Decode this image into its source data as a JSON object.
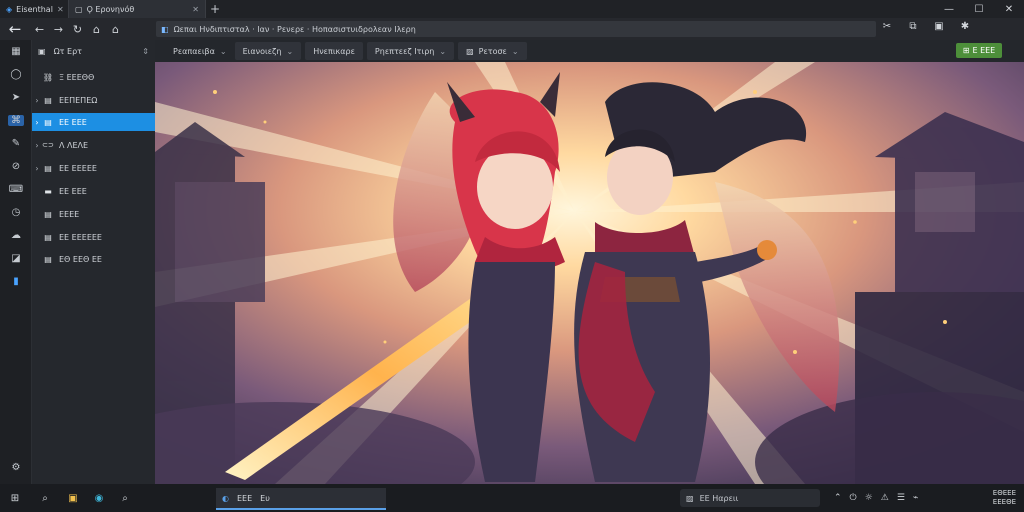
{
  "tabs": [
    {
      "label": "Eisenthal",
      "close": "✕"
    },
    {
      "label": "Ϙ Ερονηνόθ",
      "close": "✕"
    }
  ],
  "new_tab_symbol": "+",
  "window_controls": {
    "minimize": "—",
    "maximize": "☐",
    "close": "✕"
  },
  "nav": {
    "back": "←",
    "back_small": "←",
    "forward": "→",
    "reload": "↻",
    "home": "⌂",
    "home2": "⌂"
  },
  "address": {
    "text": "Ωεπαι Ηνδιπτισταλ · Ιαν · Ρενερε · Ηοπασιστυιδρολεαν Ιλερη"
  },
  "toolbar_icons": [
    "scissors-icon",
    "puzzle-icon",
    "screenshot-icon",
    "extension-icon"
  ],
  "toolbar_glyphs": [
    "✂",
    "⧉",
    "▣",
    "✱"
  ],
  "sidebar": {
    "header": "Ωτ Ερτ",
    "items": [
      {
        "label": "Ξ ΕΕΕΘΘ",
        "arrow": "",
        "icon": "⛓"
      },
      {
        "label": "ΕΕΠΕΠΕΩ",
        "arrow": "›",
        "icon": "▤"
      },
      {
        "label": "ΕΕ ΕΕΕ",
        "arrow": "›",
        "icon": "▤"
      },
      {
        "label": "Λ ΛΕΛΕ",
        "arrow": "›",
        "icon": "⊂⊃"
      },
      {
        "label": "ΕΕ ΕΕΕΕΕ",
        "arrow": "›",
        "icon": "▤"
      },
      {
        "label": "ΕΕ ΕΕΕ",
        "arrow": "",
        "icon": "▬"
      },
      {
        "label": "ΕΕΕΕ",
        "arrow": "",
        "icon": "▤"
      },
      {
        "label": "ΕΕ ΕΕΕΕΕΕ",
        "arrow": "",
        "icon": "▤"
      },
      {
        "label": "ΕΘ ΕΕΘ ΕΕ",
        "arrow": "",
        "icon": "▤"
      }
    ]
  },
  "rail_icons": [
    "grid-icon",
    "chat-icon",
    "send-icon",
    "network-icon",
    "pen-icon",
    "tag-icon",
    "terminal-icon",
    "clock-icon",
    "cloud-icon",
    "camera-icon",
    "book-icon",
    "settings-icon"
  ],
  "rail_glyphs": [
    "▦",
    "◯",
    "➤",
    "⌘",
    "✎",
    "⊘",
    "⌨",
    "◷",
    "☁",
    "◪",
    "▮",
    "⚙"
  ],
  "bookmarks": [
    {
      "label": "Ρεαπαειβα",
      "dd": "⌄"
    },
    {
      "label": "Ειανοιεζη",
      "dd": "⌄"
    },
    {
      "label": "Ηνεπικαρε",
      "dd": ""
    },
    {
      "label": "Ρηεπτεεζ Ιτιρη",
      "dd": "⌄"
    },
    {
      "label": "Ρετοσε",
      "dd": "⌄"
    }
  ],
  "green_button": {
    "label": "Ε ΕΕΕ",
    "icon": "⊞"
  },
  "taskbar": {
    "start_icon": "⊞",
    "search_icon": "⌕",
    "apps": [
      "▣",
      "◉",
      "⌕"
    ],
    "running_label1": "ΕΕΕ",
    "running_label2": "Ευ",
    "running_icon": "◐",
    "search_placeholder": "ΕΕ  Ηαρειι",
    "tray_glyphs": [
      "⌃",
      "⏻",
      "☼",
      "⚠",
      "☰",
      "⌁"
    ],
    "clock_time": "ΕΘΕΕΕ",
    "clock_date": "ΕΕΕΘΕ"
  }
}
